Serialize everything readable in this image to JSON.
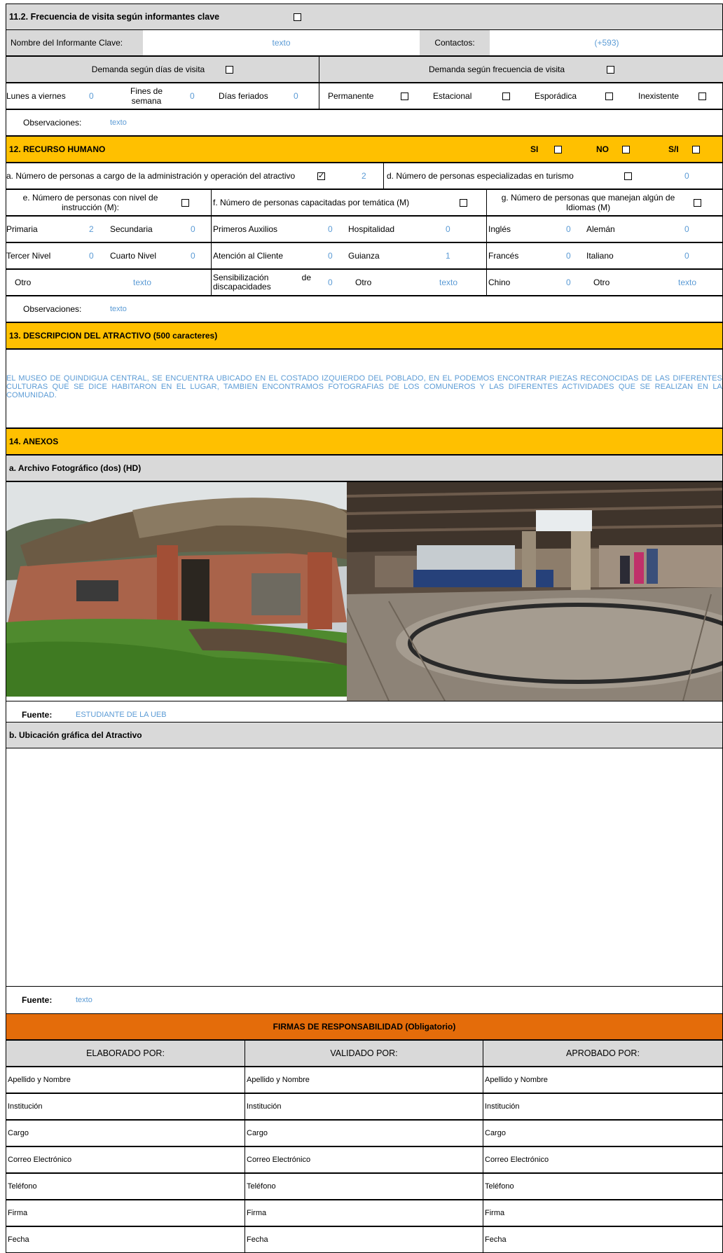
{
  "s11": {
    "title": "11.2. Frecuencia de visita según informantes clave",
    "informant_label": "Nombre del Informante Clave:",
    "informant_value": "texto",
    "contacts_label": "Contactos:",
    "contacts_value": "(+593)",
    "days_header": "Demanda según  días de visita",
    "freq_header": "Demanda según frecuencia de visita",
    "weekdays_label": "Lunes a viernes",
    "weekdays_value": "0",
    "weekends_label": "Fines de semana",
    "weekends_value": "0",
    "holidays_label": "Días feriados",
    "holidays_value": "0",
    "permanent_label": "Permanente",
    "seasonal_label": "Estacional",
    "sporadic_label": "Esporádica",
    "nonexistent_label": "Inexistente",
    "obs_label": "Observaciones:",
    "obs_value": "texto"
  },
  "s12": {
    "title": "12. RECURSO HUMANO",
    "si_label": "SI",
    "no_label": "NO",
    "sn_label": "S/I",
    "a_label": "a. Número de personas a cargo de la administración y operación del atractivo",
    "a_value": "2",
    "d_label": "d. Número de personas especializadas en turismo",
    "d_value": "0",
    "e_label": "e. Número de personas con nivel de instrucción (M):",
    "f_label": "f. Número de personas capacitadas por temática (M)",
    "g_label": "g. Número de personas que manejan algún de Idiomas (M)",
    "primaria_label": "Primaria",
    "primaria_value": "2",
    "secundaria_label": "Secundaria",
    "secundaria_value": "0",
    "tercer_label": "Tercer Nivel",
    "tercer_value": "0",
    "cuarto_label": "Cuarto Nivel",
    "cuarto_value": "0",
    "otro1_label": "Otro",
    "otro1_value": "texto",
    "auxilios_label": "Primeros Auxilios",
    "auxilios_value": "0",
    "hospitalidad_label": "Hospitalidad",
    "hospitalidad_value": "0",
    "atencion_label": "Atención al Cliente",
    "atencion_value": "0",
    "guianza_label": "Guianza",
    "guianza_value": "1",
    "sensib_label": "Sensibilización de discapacidades",
    "sensib_value": "0",
    "otro2_label": "Otro",
    "otro2_value": "texto",
    "ingles_label": "Inglés",
    "ingles_value": "0",
    "aleman_label": "Alemán",
    "aleman_value": "0",
    "frances_label": "Francés",
    "frances_value": "0",
    "italiano_label": "Italiano",
    "italiano_value": "0",
    "chino_label": "Chino",
    "chino_value": "0",
    "otro3_label": "Otro",
    "otro3_value": "texto",
    "obs_label": "Observaciones:",
    "obs_value": "texto"
  },
  "s13": {
    "title": "13. DESCRIPCION DEL ATRACTIVO (500 caracteres)",
    "text": "EL MUSEO DE QUINDIGUA CENTRAL, SE ENCUENTRA UBICADO EN EL COSTADO IZQUIERDO DEL POBLADO, EN EL PODEMOS ENCONTRAR PIEZAS RECONOCIDAS DE LAS DIFERENTES CULTURAS QUE SE DICE HABITARON EN EL LUGAR, TAMBIEN ENCONTRAMOS FOTOGRAFIAS DE LOS COMUNEROS Y LAS DIFERENTES ACTIVIDADES QUE SE REALIZAN EN LA COMUNIDAD."
  },
  "s14": {
    "title": "14. ANEXOS",
    "photo_title": "a. Archivo Fotográfico (dos) (HD)",
    "fuente_label": "Fuente:",
    "photo_source": "ESTUDIANTE DE LA UEB",
    "location_title": "b. Ubicación gráfica del Atractivo",
    "location_source": "texto"
  },
  "signatures": {
    "title": "FIRMAS DE RESPONSABILIDAD (Obligatorio)",
    "columns": [
      "ELABORADO POR:",
      "VALIDADO  POR:",
      "APROBADO POR:"
    ],
    "fields": [
      "Apellido y Nombre",
      "Institución",
      "Cargo",
      "Correo Electrónico",
      "Teléfono",
      "Firma",
      "Fecha"
    ]
  },
  "colors": {
    "header_yellow": "#ffc000",
    "signature_orange": "#e46c0a",
    "value_blue": "#5b9bd5",
    "grey": "#d9d9d9"
  }
}
